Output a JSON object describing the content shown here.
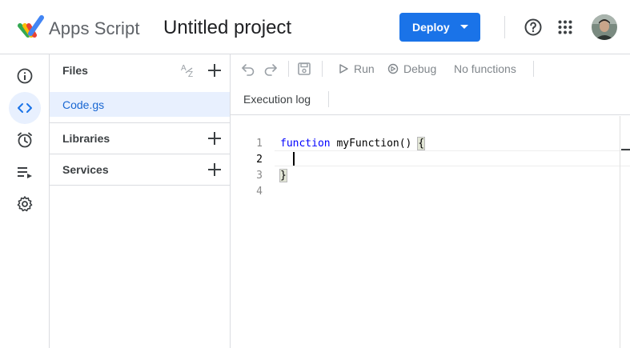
{
  "header": {
    "app_name": "Apps Script",
    "project_title": "Untitled project",
    "deploy_label": "Deploy"
  },
  "rail": {
    "items": [
      {
        "name": "overview",
        "icon": "info-icon"
      },
      {
        "name": "editor",
        "icon": "code-icon",
        "active": true
      },
      {
        "name": "triggers",
        "icon": "alarm-clock-icon"
      },
      {
        "name": "executions",
        "icon": "list-play-icon"
      },
      {
        "name": "project-settings",
        "icon": "gear-icon"
      }
    ]
  },
  "files_panel": {
    "files_title": "Files",
    "files": [
      "Code.gs"
    ],
    "libraries_title": "Libraries",
    "services_title": "Services"
  },
  "toolbar": {
    "run_label": "Run",
    "debug_label": "Debug",
    "function_select": "No functions",
    "execution_log_label": "Execution log"
  },
  "editor": {
    "line_numbers": [
      "1",
      "2",
      "3",
      "4"
    ],
    "code": {
      "keyword": "function",
      "name": " myFunction() ",
      "open_brace": "{",
      "close_brace": "}"
    }
  },
  "colors": {
    "accent": "#1a73e8",
    "active_bg": "#e8f0fe",
    "file_text": "#1967d2"
  }
}
